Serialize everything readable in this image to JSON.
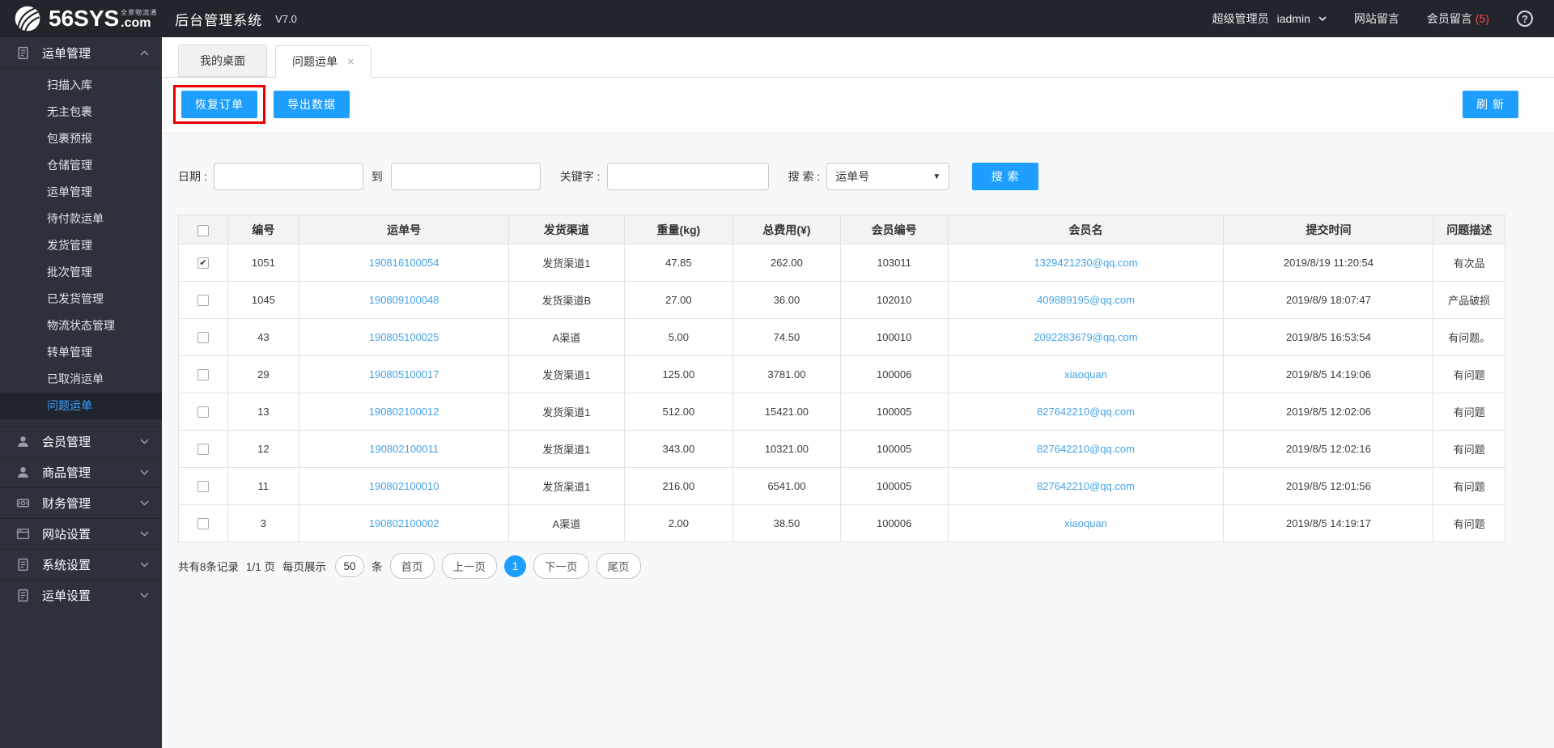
{
  "header": {
    "logo": {
      "brand": "56SYS",
      "tld": ".com",
      "tagline": "全景物流通",
      "title": "后台管理系统",
      "version": "V7.0"
    },
    "right": {
      "role": "超级管理员",
      "username": "iadmin",
      "site_messages": "网站留言",
      "member_messages": "会员留言",
      "member_message_count": "(5)",
      "count_color": "#ff4a4a",
      "help": "?"
    }
  },
  "sidebar": {
    "groups": [
      {
        "label": "运单管理",
        "icon": "waybill-doc-icon",
        "expanded": true,
        "children": [
          "扫描入库",
          "无主包裹",
          "包裹预报",
          "仓储管理",
          "运单管理",
          "待付款运单",
          "发货管理",
          "批次管理",
          "已发货管理",
          "物流状态管理",
          "转单管理",
          "已取消运单",
          "问题运单"
        ],
        "active_child": "问题运单"
      },
      {
        "label": "会员管理",
        "icon": "user-icon",
        "expanded": false
      },
      {
        "label": "商品管理",
        "icon": "user-icon",
        "expanded": false
      },
      {
        "label": "财务管理",
        "icon": "money-icon",
        "expanded": false
      },
      {
        "label": "网站设置",
        "icon": "browser-icon",
        "expanded": false
      },
      {
        "label": "系统设置",
        "icon": "doc-icon",
        "expanded": false
      },
      {
        "label": "运单设置",
        "icon": "doc-icon",
        "expanded": false
      }
    ]
  },
  "tabs": [
    {
      "label": "我的桌面",
      "active": false,
      "closable": false
    },
    {
      "label": "问题运单",
      "active": true,
      "closable": true,
      "close_glyph": "×"
    }
  ],
  "toolbar": {
    "restore_label": "恢复订单",
    "export_label": "导出数据",
    "refresh_label": "刷 新",
    "accent_color": "#1E9FFF",
    "annotation_color": "#e60000"
  },
  "filters": {
    "date_label": "日期 :",
    "to_label": "到",
    "keyword_label": "关键字 :",
    "search_label": "搜 索 :",
    "search_type_value": "运单号",
    "search_button": "搜 索",
    "date_from_value": "",
    "date_to_value": "",
    "keyword_value": ""
  },
  "table": {
    "headers": [
      "编号",
      "运单号",
      "发货渠道",
      "重量(kg)",
      "总费用(¥)",
      "会员编号",
      "会员名",
      "提交时间",
      "问题描述"
    ],
    "link_color": "#45a3e5",
    "rows": [
      {
        "checked": true,
        "id": "1051",
        "waybill_no": "190816100054",
        "channel": "发货渠道1",
        "weight": "47.85",
        "total_fee": "262.00",
        "member_id": "103011",
        "member_name": "1329421230@qq.com",
        "submit_time": "2019/8/19 11:20:54",
        "issue": "有次品"
      },
      {
        "checked": false,
        "id": "1045",
        "waybill_no": "190809100048",
        "channel": "发货渠道B",
        "weight": "27.00",
        "total_fee": "36.00",
        "member_id": "102010",
        "member_name": "409889195@qq.com",
        "submit_time": "2019/8/9 18:07:47",
        "issue": "产品破损"
      },
      {
        "checked": false,
        "id": "43",
        "waybill_no": "190805100025",
        "channel": "A渠道",
        "weight": "5.00",
        "total_fee": "74.50",
        "member_id": "100010",
        "member_name": "2092283679@qq.com",
        "submit_time": "2019/8/5 16:53:54",
        "issue": "有问题。"
      },
      {
        "checked": false,
        "id": "29",
        "waybill_no": "190805100017",
        "channel": "发货渠道1",
        "weight": "125.00",
        "total_fee": "3781.00",
        "member_id": "100006",
        "member_name": "xiaoquan",
        "submit_time": "2019/8/5 14:19:06",
        "issue": "有问题"
      },
      {
        "checked": false,
        "id": "13",
        "waybill_no": "190802100012",
        "channel": "发货渠道1",
        "weight": "512.00",
        "total_fee": "15421.00",
        "member_id": "100005",
        "member_name": "827642210@qq.com",
        "submit_time": "2019/8/5 12:02:06",
        "issue": "有问题"
      },
      {
        "checked": false,
        "id": "12",
        "waybill_no": "190802100011",
        "channel": "发货渠道1",
        "weight": "343.00",
        "total_fee": "10321.00",
        "member_id": "100005",
        "member_name": "827642210@qq.com",
        "submit_time": "2019/8/5 12:02:16",
        "issue": "有问题"
      },
      {
        "checked": false,
        "id": "11",
        "waybill_no": "190802100010",
        "channel": "发货渠道1",
        "weight": "216.00",
        "total_fee": "6541.00",
        "member_id": "100005",
        "member_name": "827642210@qq.com",
        "submit_time": "2019/8/5 12:01:56",
        "issue": "有问题"
      },
      {
        "checked": false,
        "id": "3",
        "waybill_no": "190802100002",
        "channel": "A渠道",
        "weight": "2.00",
        "total_fee": "38.50",
        "member_id": "100006",
        "member_name": "xiaoquan",
        "submit_time": "2019/8/5 14:19:17",
        "issue": "有问题"
      }
    ]
  },
  "pagination": {
    "total_text": "共有8条记录",
    "page_text": "1/1 页",
    "per_page_label": "每页展示",
    "per_page_value": "50",
    "unit_label": "条",
    "first": "首页",
    "prev": "上一页",
    "current": "1",
    "next": "下一页",
    "last": "尾页"
  }
}
